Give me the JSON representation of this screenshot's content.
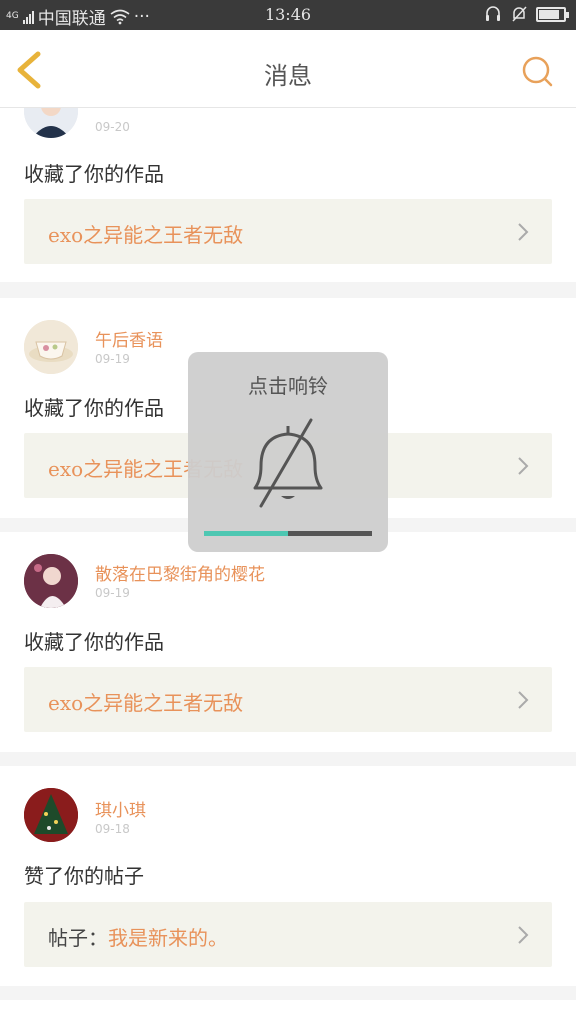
{
  "statusbar": {
    "network": "4G",
    "carrier": "中国联通",
    "more": "···",
    "time": "13:46",
    "battery_level": 0.85
  },
  "header": {
    "title": "消息",
    "back_icon": "chevron-left-icon",
    "search_icon": "search-icon",
    "accent_color": "#e8a15a"
  },
  "messages": [
    {
      "username": "",
      "date": "09-20",
      "action": "收藏了你的作品",
      "ref_prefix": "",
      "ref_title": "exo之异能之王者无敌"
    },
    {
      "username": "午后香语",
      "date": "09-19",
      "action": "收藏了你的作品",
      "ref_prefix": "",
      "ref_title": "exo之异能之王者无敌"
    },
    {
      "username": "散落在巴黎街角的樱花",
      "date": "09-19",
      "action": "收藏了你的作品",
      "ref_prefix": "",
      "ref_title": "exo之异能之王者无敌"
    },
    {
      "username": "琪小琪",
      "date": "09-18",
      "action": "赞了你的帖子",
      "ref_prefix": "帖子：",
      "ref_title": "我是新来的。"
    }
  ],
  "toast": {
    "title": "点击响铃",
    "icon": "bell-off-icon",
    "volume": 0.5,
    "fill_color": "#4ec7b2"
  }
}
